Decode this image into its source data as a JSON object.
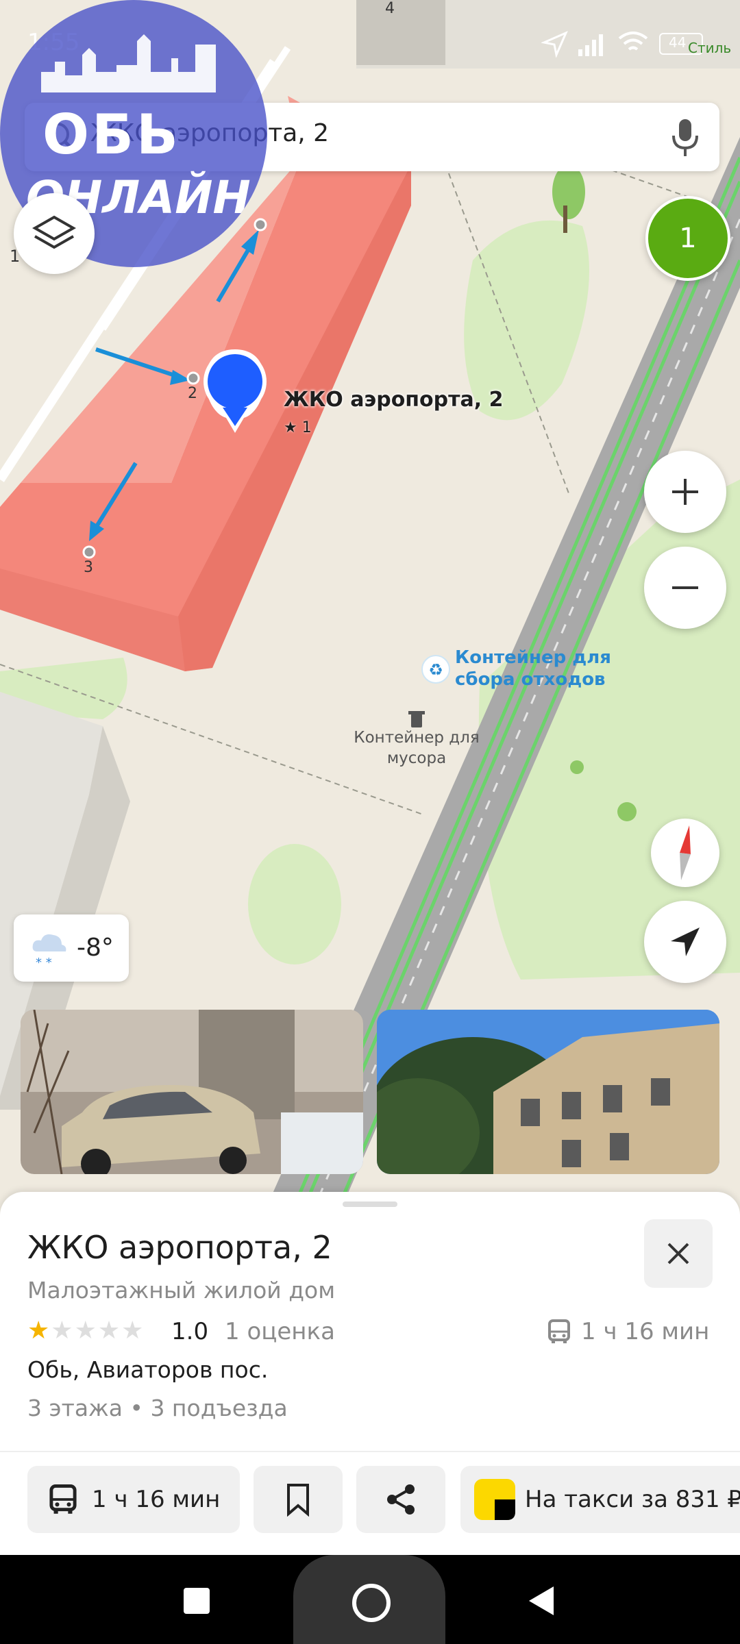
{
  "status": {
    "time": "1:55",
    "battery": "44",
    "carrier_short": "Стиль"
  },
  "watermark": {
    "line1": "ОБЬ",
    "line2": "ОНЛАЙН"
  },
  "search": {
    "query": "ЖКО аэропорта, 2",
    "left_level": "1"
  },
  "map": {
    "entrance_badge": "1",
    "pin_label": "ЖКО аэропорта, 2",
    "pin_rating": "★ 1",
    "entrances": [
      "2",
      "3"
    ],
    "top_number": "4",
    "poi_recycle": "Контейнер для\nсбора отходов",
    "poi_trash": "Контейнер для\nмусора",
    "colors": {
      "building": "#f4877b",
      "pin": "#1e5eff",
      "arrow": "#1a8fd8",
      "badge": "#5aab12",
      "road_line": "#6bd36b"
    }
  },
  "weather": {
    "temp": "-8°"
  },
  "sheet": {
    "title": "ЖКО аэропорта, 2",
    "subtitle": "Малоэтажный жилой дом",
    "rating_value": "1.0",
    "rating_count": "1 оценка",
    "stars_filled": 1,
    "stars_total": 5,
    "transit_time": "1 ч 16 мин",
    "address": "Обь, Авиаторов пос.",
    "details": "3 этажа • 3 подъезда",
    "btn_route": "1 ч 16 мин",
    "btn_taxi": "На такси за 831 ₽"
  }
}
